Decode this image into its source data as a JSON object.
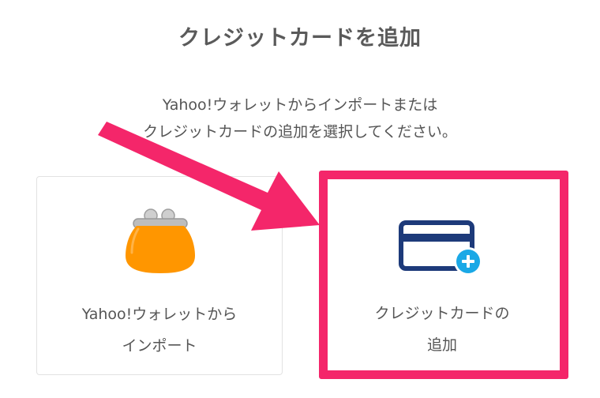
{
  "dialog": {
    "title": "クレジットカードを追加",
    "description_line1": "Yahoo!ウォレットからインポートまたは",
    "description_line2": "クレジットカードの追加を選択してください。"
  },
  "options": {
    "wallet": {
      "label_line1": "Yahoo!ウォレットから",
      "label_line2": "インポート",
      "icon": "coin-purse-icon"
    },
    "credit": {
      "label_line1": "クレジットカードの",
      "label_line2": "追加",
      "icon": "credit-card-add-icon"
    }
  },
  "colors": {
    "highlight": "#f4266a",
    "purse": "#ff9600",
    "card": "#1d3a7a",
    "plus_badge": "#1aa8e6"
  }
}
